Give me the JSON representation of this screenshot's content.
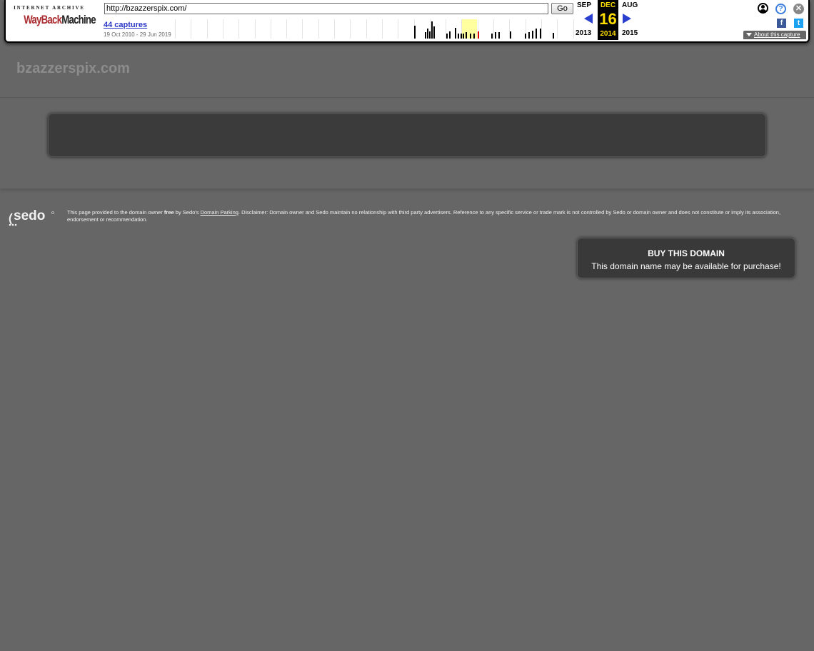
{
  "wayback": {
    "logo_top": "INTERNET ARCHIVE",
    "logo_way": "WayBack",
    "logo_machine": "Machine",
    "url": "http://bzazzerspix.com/",
    "go_label": "Go",
    "captures_label": "44 captures",
    "date_range": "19 Oct 2010 - 29 Jun 2019",
    "prev_month": "SEP",
    "cur_month": "DEC",
    "next_month": "AUG",
    "cur_day": "16",
    "prev_year": "2013",
    "cur_year": "2014",
    "next_year": "2015",
    "about_label": "About this capture",
    "icons": [
      "user-icon",
      "help-icon",
      "close-icon",
      "facebook-icon",
      "twitter-icon"
    ],
    "colors": {
      "arrow": "#2b3fcf",
      "current": "#ffde00",
      "highlight": "#ffffa0"
    }
  },
  "site": {
    "title": "bzazzerspix.com"
  },
  "footer": {
    "sedo_logo": "sedo",
    "disclaimer_pre": "This page provided to the domain owner ",
    "disclaimer_free": "free",
    "disclaimer_mid": " by Sedo's ",
    "disclaimer_link": "Domain Parking",
    "disclaimer_post": ". Disclaimer: Domain owner and Sedo maintain no relationship with third party advertisers. Reference to any specific service or trade mark is not controlled by Sedo or domain owner and does not constitute or imply its association, endorsement or recommendation."
  },
  "buy": {
    "title": "BUY THIS DOMAIN",
    "subtitle": "This domain name may be available for purchase!"
  }
}
